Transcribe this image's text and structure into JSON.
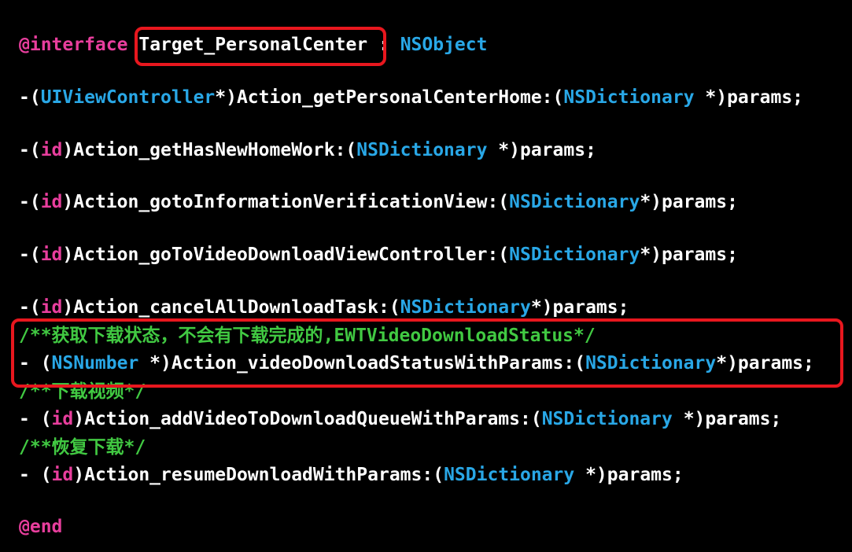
{
  "code": {
    "interface_keyword": "@interface",
    "class_name": "Target_PersonalCenter",
    "colon": " : ",
    "superclass": "NSObject",
    "m1": {
      "pre": "-(",
      "type": "UIViewController",
      "mid": "*)Action_getPersonalCenterHome:(",
      "ptype": "NSDictionary",
      "post": " *)params;"
    },
    "m2": {
      "pre": "-(",
      "type": "id",
      "mid": ")Action_getHasNewHomeWork:(",
      "ptype": "NSDictionary",
      "post": " *)params;"
    },
    "m3": {
      "pre": "-(",
      "type": "id",
      "mid": ")Action_gotoInformationVerificationView:(",
      "ptype": "NSDictionary",
      "post": "*)params;"
    },
    "m4": {
      "pre": "-(",
      "type": "id",
      "mid": ")Action_goToVideoDownloadViewController:(",
      "ptype": "NSDictionary",
      "post": "*)params;"
    },
    "m5": {
      "pre": "-(",
      "type": "id",
      "mid": ")Action_cancelAllDownloadTask:(",
      "ptype": "NSDictionary",
      "post": "*)params;"
    },
    "comment1": "/**获取下载状态，不会有下载完成的,EWTVideoDownloadStatus*/",
    "m6": {
      "pre": "- (",
      "type": "NSNumber",
      "mid": " *)Action_videoDownloadStatusWithParams:(",
      "ptype": "NSDictionary",
      "post": "*)params;"
    },
    "comment2": "/**下载视频*/",
    "m7": {
      "pre": "- (",
      "type": "id",
      "mid": ")Action_addVideoToDownloadQueueWithParams:(",
      "ptype": "NSDictionary",
      "post": " *)params;"
    },
    "comment3": "/**恢复下载*/",
    "m8": {
      "pre": "- (",
      "type": "id",
      "mid": ")Action_resumeDownloadWithParams:(",
      "ptype": "NSDictionary",
      "post": " *)params;"
    },
    "end_keyword": "@end"
  },
  "colors": {
    "keyword": "#e83e9d",
    "type": "#29a7e6",
    "comment": "#41c942",
    "highlight_box": "#e8171e",
    "background": "#000000"
  }
}
